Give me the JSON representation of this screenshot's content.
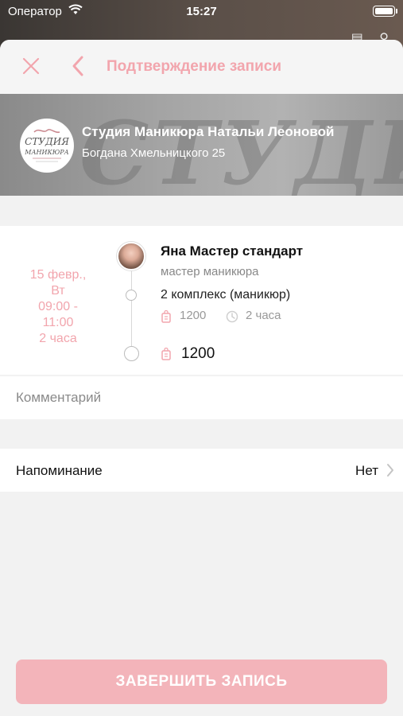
{
  "status_bar": {
    "carrier": "Оператор",
    "time": "15:27"
  },
  "nav": {
    "title": "Подтверждение записи"
  },
  "salon": {
    "watermark": "СТУДИЯ",
    "name": "Студия Маникюра Натальи Леоновой",
    "address": "Богдана Хмельницкого 25"
  },
  "appointment": {
    "date": "15 февр.,",
    "weekday": "Вт",
    "time_start": "09:00 -",
    "time_end": "11:00",
    "duration": "2 часа",
    "master": {
      "name": "Яна Мастер стандарт",
      "role": "мастер маникюра"
    },
    "service": {
      "name": "2 комплекс (маникюр)",
      "price": "1200",
      "duration": "2 часа"
    },
    "total": "1200"
  },
  "comment": {
    "placeholder": "Комментарий",
    "value": ""
  },
  "reminder": {
    "label": "Напоминание",
    "value": "Нет"
  },
  "finish_button": {
    "label": "ЗАВЕРШИТЬ ЗАПИСЬ"
  },
  "colors": {
    "accent": "#f2a5ad",
    "button": "#f3b4ba",
    "background": "#f2f2f2"
  }
}
